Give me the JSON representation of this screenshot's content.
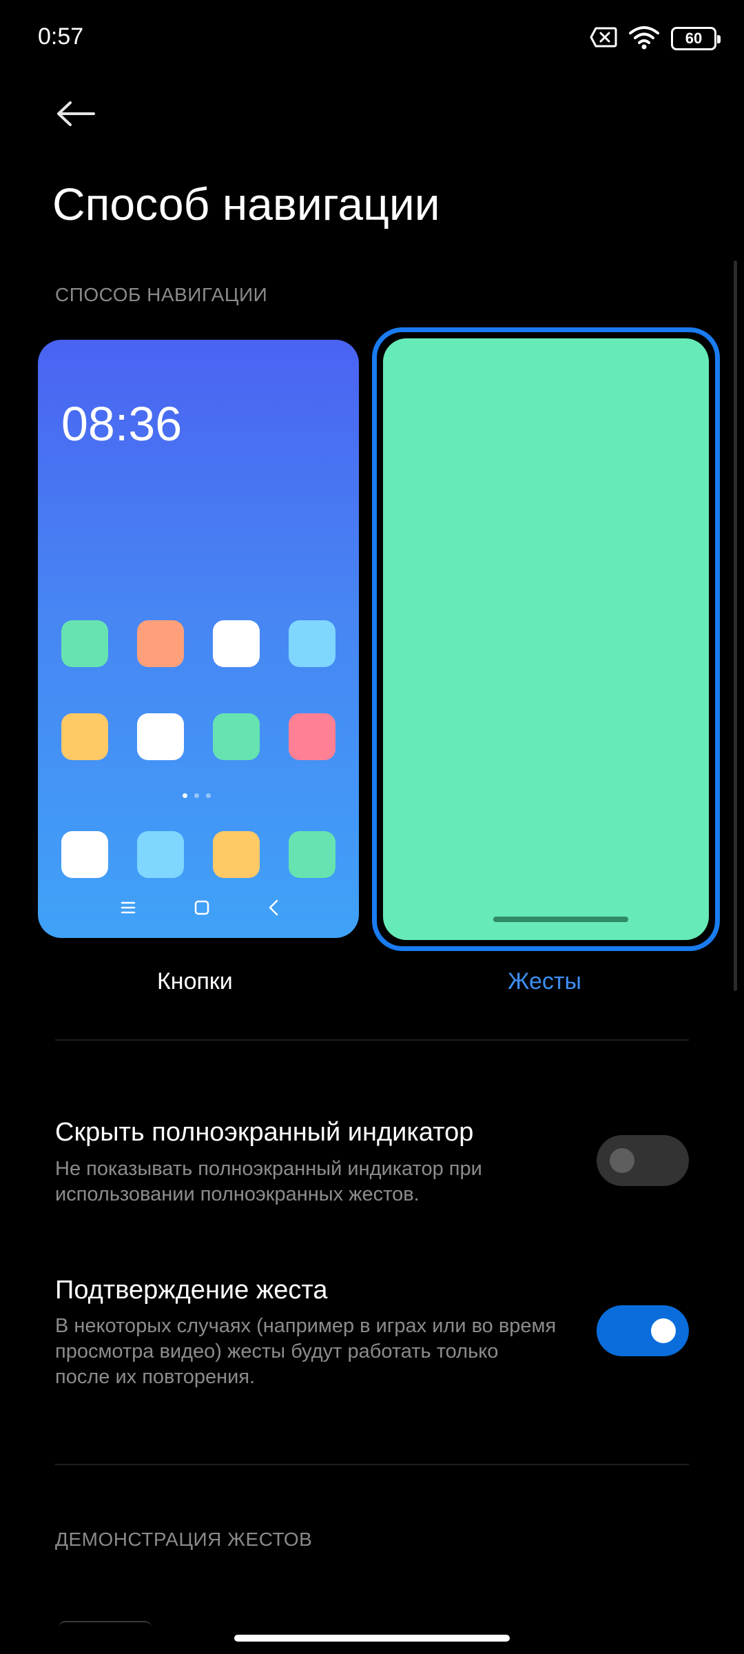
{
  "status_bar": {
    "time": "0:57",
    "battery": "60",
    "icons": [
      "sim-none-icon",
      "wifi-icon",
      "battery-icon"
    ]
  },
  "header": {
    "back_icon": "arrow-left-icon",
    "title": "Способ навигации"
  },
  "section_navigation": {
    "label": "СПОСОБ НАВИГАЦИИ",
    "options": [
      {
        "label": "Кнопки",
        "selected": false,
        "preview_time": "08:36"
      },
      {
        "label": "Жесты",
        "selected": true
      }
    ]
  },
  "settings": [
    {
      "title": "Скрыть полноэкранный индикатор",
      "description": "Не показывать полноэкранный индикатор при использовании полноэкранных жестов.",
      "enabled": false
    },
    {
      "title": "Подтверждение жеста",
      "description": "В некоторых случаях (например в играх или во время просмотра видео) жесты будут работать только после их повторения.",
      "enabled": true
    }
  ],
  "section_demo": {
    "label": "ДЕМОНСТРАЦИЯ ЖЕСТОВ"
  },
  "colors": {
    "accent": "#1a7cf0",
    "selected_label": "#3d8ff2",
    "gesture_preview_bg": "#66eab8",
    "toggle_on": "#0a6ddb"
  }
}
